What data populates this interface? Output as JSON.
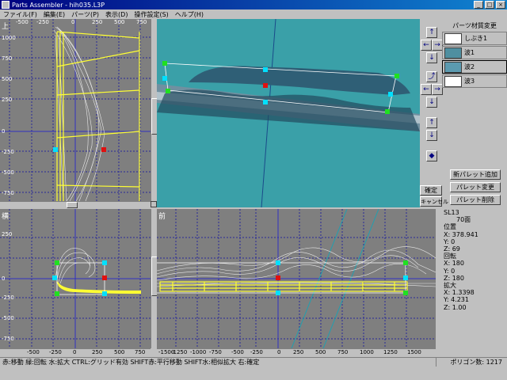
{
  "window": {
    "title": "Parts Assembler - hih035.L3P",
    "min": "_",
    "max": "□",
    "close": "×"
  },
  "menu": [
    "ファイル(F)",
    "編集(E)",
    "パーツ(P)",
    "表示(D)",
    "操作設定(S)",
    "ヘルプ(H)"
  ],
  "viewports": {
    "top": {
      "label": "上"
    },
    "side": {
      "label": "横"
    },
    "front": {
      "label": "前"
    }
  },
  "ticks": {
    "top_x": [
      "-500",
      "-250",
      "0",
      "250",
      "500",
      "750"
    ],
    "top_y": [
      "1000",
      "750",
      "500",
      "250",
      "0",
      "-250",
      "-500",
      "-750"
    ],
    "side_x": [
      "-500",
      "-250",
      "0",
      "250",
      "500",
      "750"
    ],
    "side_y": [
      "250",
      "0",
      "-250",
      "-500",
      "-750"
    ],
    "front_x": [
      "-1500",
      "-1250",
      "-1000",
      "-750",
      "-500",
      "-250",
      "0",
      "250",
      "500",
      "750",
      "1000",
      "1250",
      "1500"
    ]
  },
  "material_panel": {
    "header": "パーツ材質変更",
    "items": [
      {
        "name": "しぶき1",
        "color": "#ffffff"
      },
      {
        "name": "波1",
        "color": "#4f8fa0"
      },
      {
        "name": "波2",
        "color": "#5b9ab0"
      },
      {
        "name": "波3",
        "color": "#ffffff"
      }
    ]
  },
  "palette_buttons": {
    "add": "新パレット追加",
    "change": "パレット変更",
    "delete": "パレット削除"
  },
  "confirm_buttons": {
    "ok": "確定",
    "cancel": "キャンセル"
  },
  "arrows": {
    "up": "↑",
    "down": "↓",
    "left": "←",
    "right": "→",
    "rot": "⤴",
    "diamond": "◆"
  },
  "info": {
    "lines": [
      "SL13",
      "70面",
      "位置",
      "X: 378.941",
      "Y: 0",
      "Z: 69",
      "回転",
      "X: 180",
      "Y: 0",
      "Z: 180",
      "拡大",
      "X: 1.3398",
      "Y: 4.231",
      "Z: 1.00"
    ]
  },
  "status": {
    "hint": "赤:移動 緑:回転 水:拡大 CTRL:グリッド有効 SHIFT赤:平行移動 SHIFT水:相似拡大 右:確定",
    "polygons": "ポリゴン数: 1217"
  },
  "colors": {
    "viewport_bg": "#7f7f7f",
    "render_bg": "#3aa0a8",
    "grid": "#2a2a9a",
    "wire": "#e8e8e8",
    "selected": "#ffff33"
  }
}
